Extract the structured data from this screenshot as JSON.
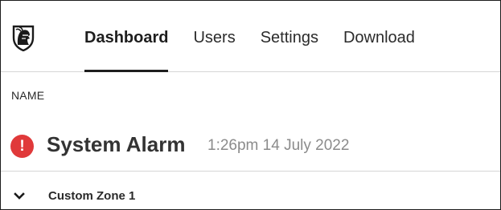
{
  "nav": {
    "logo_icon": "knight-helmet-shield-icon",
    "tabs": [
      {
        "label": "Dashboard",
        "active": true
      },
      {
        "label": "Users",
        "active": false
      },
      {
        "label": "Settings",
        "active": false
      },
      {
        "label": "Download",
        "active": false
      }
    ]
  },
  "table": {
    "column_header": "NAME"
  },
  "alarm": {
    "icon": "exclamation-circle-icon",
    "icon_glyph": "!",
    "title": "System Alarm",
    "timestamp": "1:26pm 14 July 2022",
    "status_color": "#e0393a"
  },
  "zone": {
    "chevron_icon": "chevron-down-icon",
    "label": "Custom Zone 1"
  }
}
